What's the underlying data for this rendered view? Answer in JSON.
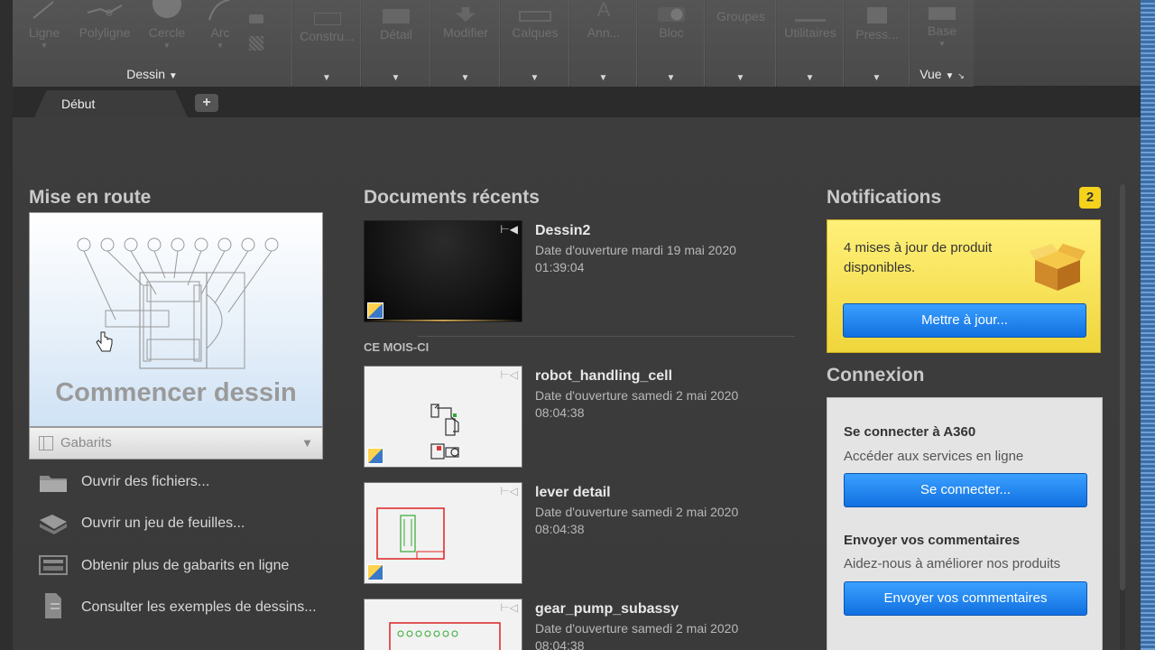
{
  "ribbon": {
    "draw_tools": [
      {
        "label": "Ligne",
        "icon": "line-icon"
      },
      {
        "label": "Polyligne",
        "icon": "polyline-icon"
      },
      {
        "label": "Cercle",
        "icon": "circle-icon"
      },
      {
        "label": "Arc",
        "icon": "arc-icon"
      }
    ],
    "draw_panel_title": "Dessin",
    "panels": [
      {
        "label": "Constru..."
      },
      {
        "label": "Détail"
      },
      {
        "label": "Modifier"
      },
      {
        "label": "Calques"
      },
      {
        "label": "Ann..."
      },
      {
        "label": "Bloc"
      },
      {
        "label": "Groupes"
      },
      {
        "label": "Utilitaires"
      },
      {
        "label": "Press..."
      }
    ],
    "view_panel": {
      "tool_label": "Base",
      "title": "Vue"
    }
  },
  "tabs": {
    "active": "Début",
    "add_label": "+"
  },
  "getting_started": {
    "heading": "Mise en route",
    "start_label": "Commencer dessin",
    "templates_label": "Gabarits",
    "links": [
      {
        "label": "Ouvrir des fichiers...",
        "icon": "folder-icon"
      },
      {
        "label": "Ouvrir un jeu de feuilles...",
        "icon": "sheet-set-icon"
      },
      {
        "label": "Obtenir plus de gabarits en ligne",
        "icon": "templates-online-icon"
      },
      {
        "label": "Consulter les exemples de dessins...",
        "icon": "sample-drawings-icon"
      }
    ]
  },
  "recent": {
    "heading": "Documents récents",
    "month_label": "CE MOIS-CI",
    "documents": [
      {
        "name": "Dessin2",
        "date_line1": "Date d'ouverture mardi 19 mai 2020",
        "date_line2": "01:39:04"
      },
      {
        "name": "robot_handling_cell",
        "date_line1": "Date d'ouverture samedi 2 mai 2020",
        "date_line2": "08:04:38"
      },
      {
        "name": "lever detail",
        "date_line1": "Date d'ouverture samedi 2 mai 2020",
        "date_line2": "08:04:38"
      },
      {
        "name": "gear_pump_subassy",
        "date_line1": "Date d'ouverture samedi 2 mai 2020",
        "date_line2": "08:04:38"
      }
    ]
  },
  "notifications": {
    "heading": "Notifications",
    "count": "2",
    "message": "4 mises à jour de produit disponibles.",
    "update_button": "Mettre à jour..."
  },
  "connection": {
    "heading": "Connexion",
    "signin_title": "Se connecter à A360",
    "signin_subtitle": "Accéder aux services en ligne",
    "signin_button": "Se connecter...",
    "feedback_title": "Envoyer vos commentaires",
    "feedback_subtitle": "Aidez-nous à améliorer nos produits",
    "feedback_button": "Envoyer vos commentaires"
  },
  "colors": {
    "accent_blue": "#1e88f0",
    "notification_yellow": "#f5d21b",
    "background": "#3c3c3c"
  }
}
